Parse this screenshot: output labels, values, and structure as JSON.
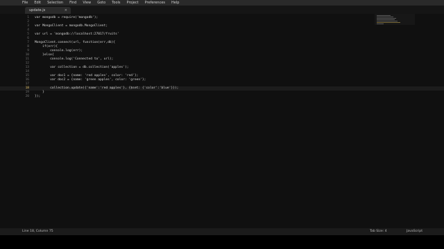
{
  "menu": [
    "File",
    "Edit",
    "Selection",
    "Find",
    "View",
    "Goto",
    "Tools",
    "Project",
    "Preferences",
    "Help"
  ],
  "tab": {
    "title": "update.js",
    "close": "×"
  },
  "code": {
    "line_numbers": [
      "1",
      "2",
      "3",
      "4",
      "5",
      "6",
      "7",
      "8",
      "9",
      "10",
      "11",
      "12",
      "13",
      "14",
      "15",
      "16",
      "17",
      "18",
      "19",
      "20"
    ],
    "lines": [
      "var mongodb = require('mongodb');",
      "",
      "var MongoClient = mongodb.MongoClient;",
      "",
      "var url = 'mongodb://localhost:27017/fruits'",
      "",
      "MongoClient.connect(url, function(err,db){",
      "    if(err){",
      "        console.log(err);",
      "    }else{",
      "        console.log('Connected to', url);",
      "",
      "        var collection = db.collection('apples');",
      "",
      "        var doc1 = {name: 'red apples', color: 'red'};",
      "        var doc2 = {name: 'green apples', color: 'green'};",
      "",
      "        collection.update({'name':'red apples'}, {$set: {'color':'blue'}});",
      "    }",
      "});"
    ],
    "highlighted_line": "18"
  },
  "status": {
    "cursor": "Line 18, Column 75",
    "tab_size": "Tab Size: 4",
    "syntax": "JavaScript"
  }
}
